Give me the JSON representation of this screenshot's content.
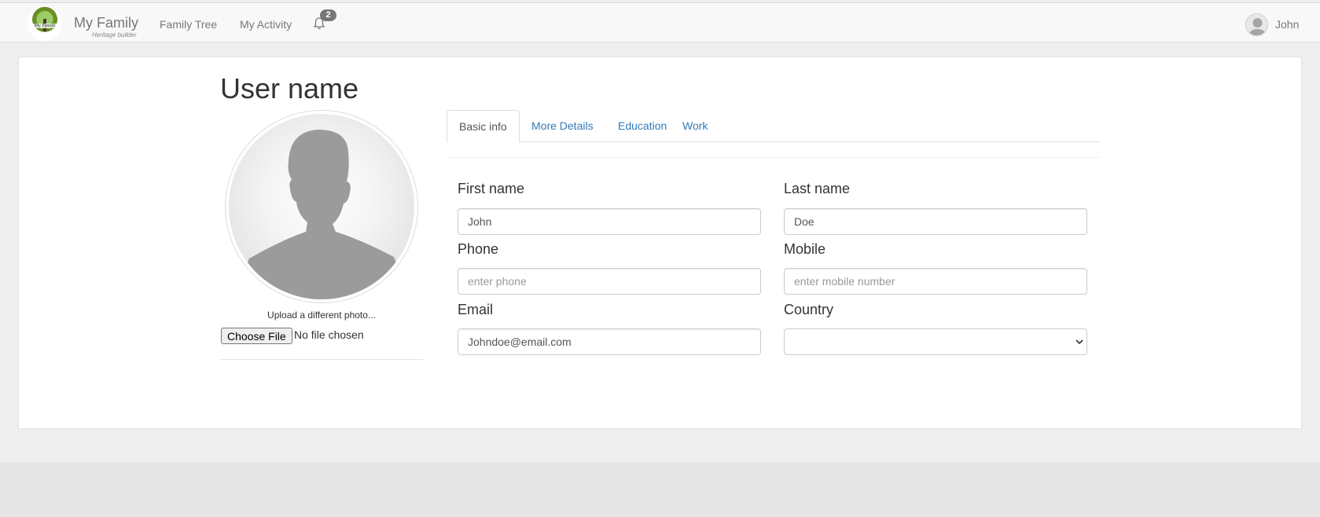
{
  "navbar": {
    "brand_name": "My Family",
    "brand_tagline": "Heritage builder",
    "logo_text": "My Family",
    "links": [
      "Family Tree",
      "My Activity"
    ],
    "notification_count": "2",
    "user_name": "John"
  },
  "profile": {
    "title": "User name",
    "upload_text": "Upload a different photo...",
    "choose_file_label": "Choose File",
    "file_status": "No file chosen"
  },
  "tabs": [
    {
      "label": "Basic info",
      "active": true
    },
    {
      "label": "More Details",
      "active": false
    },
    {
      "label": "Education",
      "active": false
    },
    {
      "label": "Work",
      "active": false
    }
  ],
  "form": {
    "first_name": {
      "label": "First name",
      "value": "John",
      "placeholder": ""
    },
    "last_name": {
      "label": "Last name",
      "value": "Doe",
      "placeholder": ""
    },
    "phone": {
      "label": "Phone",
      "value": "",
      "placeholder": "enter phone"
    },
    "mobile": {
      "label": "Mobile",
      "value": "",
      "placeholder": "enter mobile number"
    },
    "email": {
      "label": "Email",
      "value": "Johndoe@email.com",
      "placeholder": ""
    },
    "country": {
      "label": "Country",
      "value": ""
    }
  },
  "icons": {
    "bell": "bell-icon",
    "avatar": "user-silhouette-icon",
    "select_arrow": "chevron-down-icon"
  },
  "colors": {
    "link": "#337ab7",
    "badge": "#777777",
    "navbar_bg": "#f8f8f8"
  }
}
